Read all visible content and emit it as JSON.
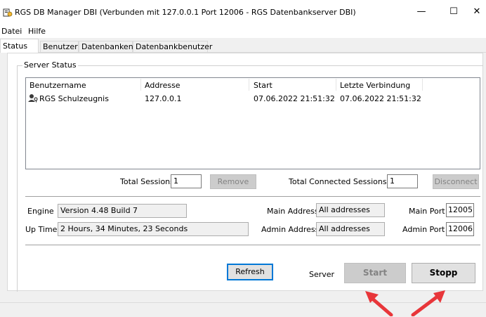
{
  "window": {
    "title": "RGS DB Manager DBI (Verbunden mit 127.0.0.1  Port 12006 - RGS Datenbankserver DBI)",
    "minimize_glyph": "—",
    "maximize_glyph": "☐",
    "close_glyph": "✕"
  },
  "menu": {
    "items": [
      "Datei",
      "Hilfe"
    ]
  },
  "tabs": [
    "Status",
    "Benutzer",
    "Datenbanken",
    "Datenbankbenutzer"
  ],
  "server_status": {
    "group_title": "Server Status",
    "columns": [
      "Benutzername",
      "Addresse",
      "Start",
      "Letzte Verbindung"
    ],
    "rows": [
      {
        "user": "RGS Schulzeugnis",
        "address": "127.0.0.1",
        "start": "07.06.2022 21:51:32",
        "last": "07.06.2022 21:51:32",
        "icon": "user-key-icon"
      }
    ]
  },
  "sessions": {
    "total_sessions_label": "Total Sessions",
    "total_sessions_value": "1",
    "remove_label": "Remove",
    "total_connected_label": "Total Connected Sessions",
    "total_connected_value": "1",
    "disconnect_label": "Disconnect"
  },
  "info": {
    "engine_label": "Engine",
    "engine_value": "Version 4.48 Build 7",
    "uptime_label": "Up Time",
    "uptime_value": "2 Hours, 34 Minutes, 23 Seconds",
    "main_address_label": "Main Address",
    "main_address_value": "All addresses",
    "admin_address_label": "Admin Address",
    "admin_address_value": "All addresses",
    "main_port_label": "Main Port",
    "main_port_value": "12005",
    "admin_port_label": "Admin Port",
    "admin_port_value": "12006"
  },
  "actions": {
    "refresh_label": "Refresh",
    "server_label": "Server",
    "start_label": "Start",
    "stop_label": "Stopp"
  },
  "colors": {
    "annotation_arrow": "#e8363a",
    "accent": "#0078d7"
  }
}
